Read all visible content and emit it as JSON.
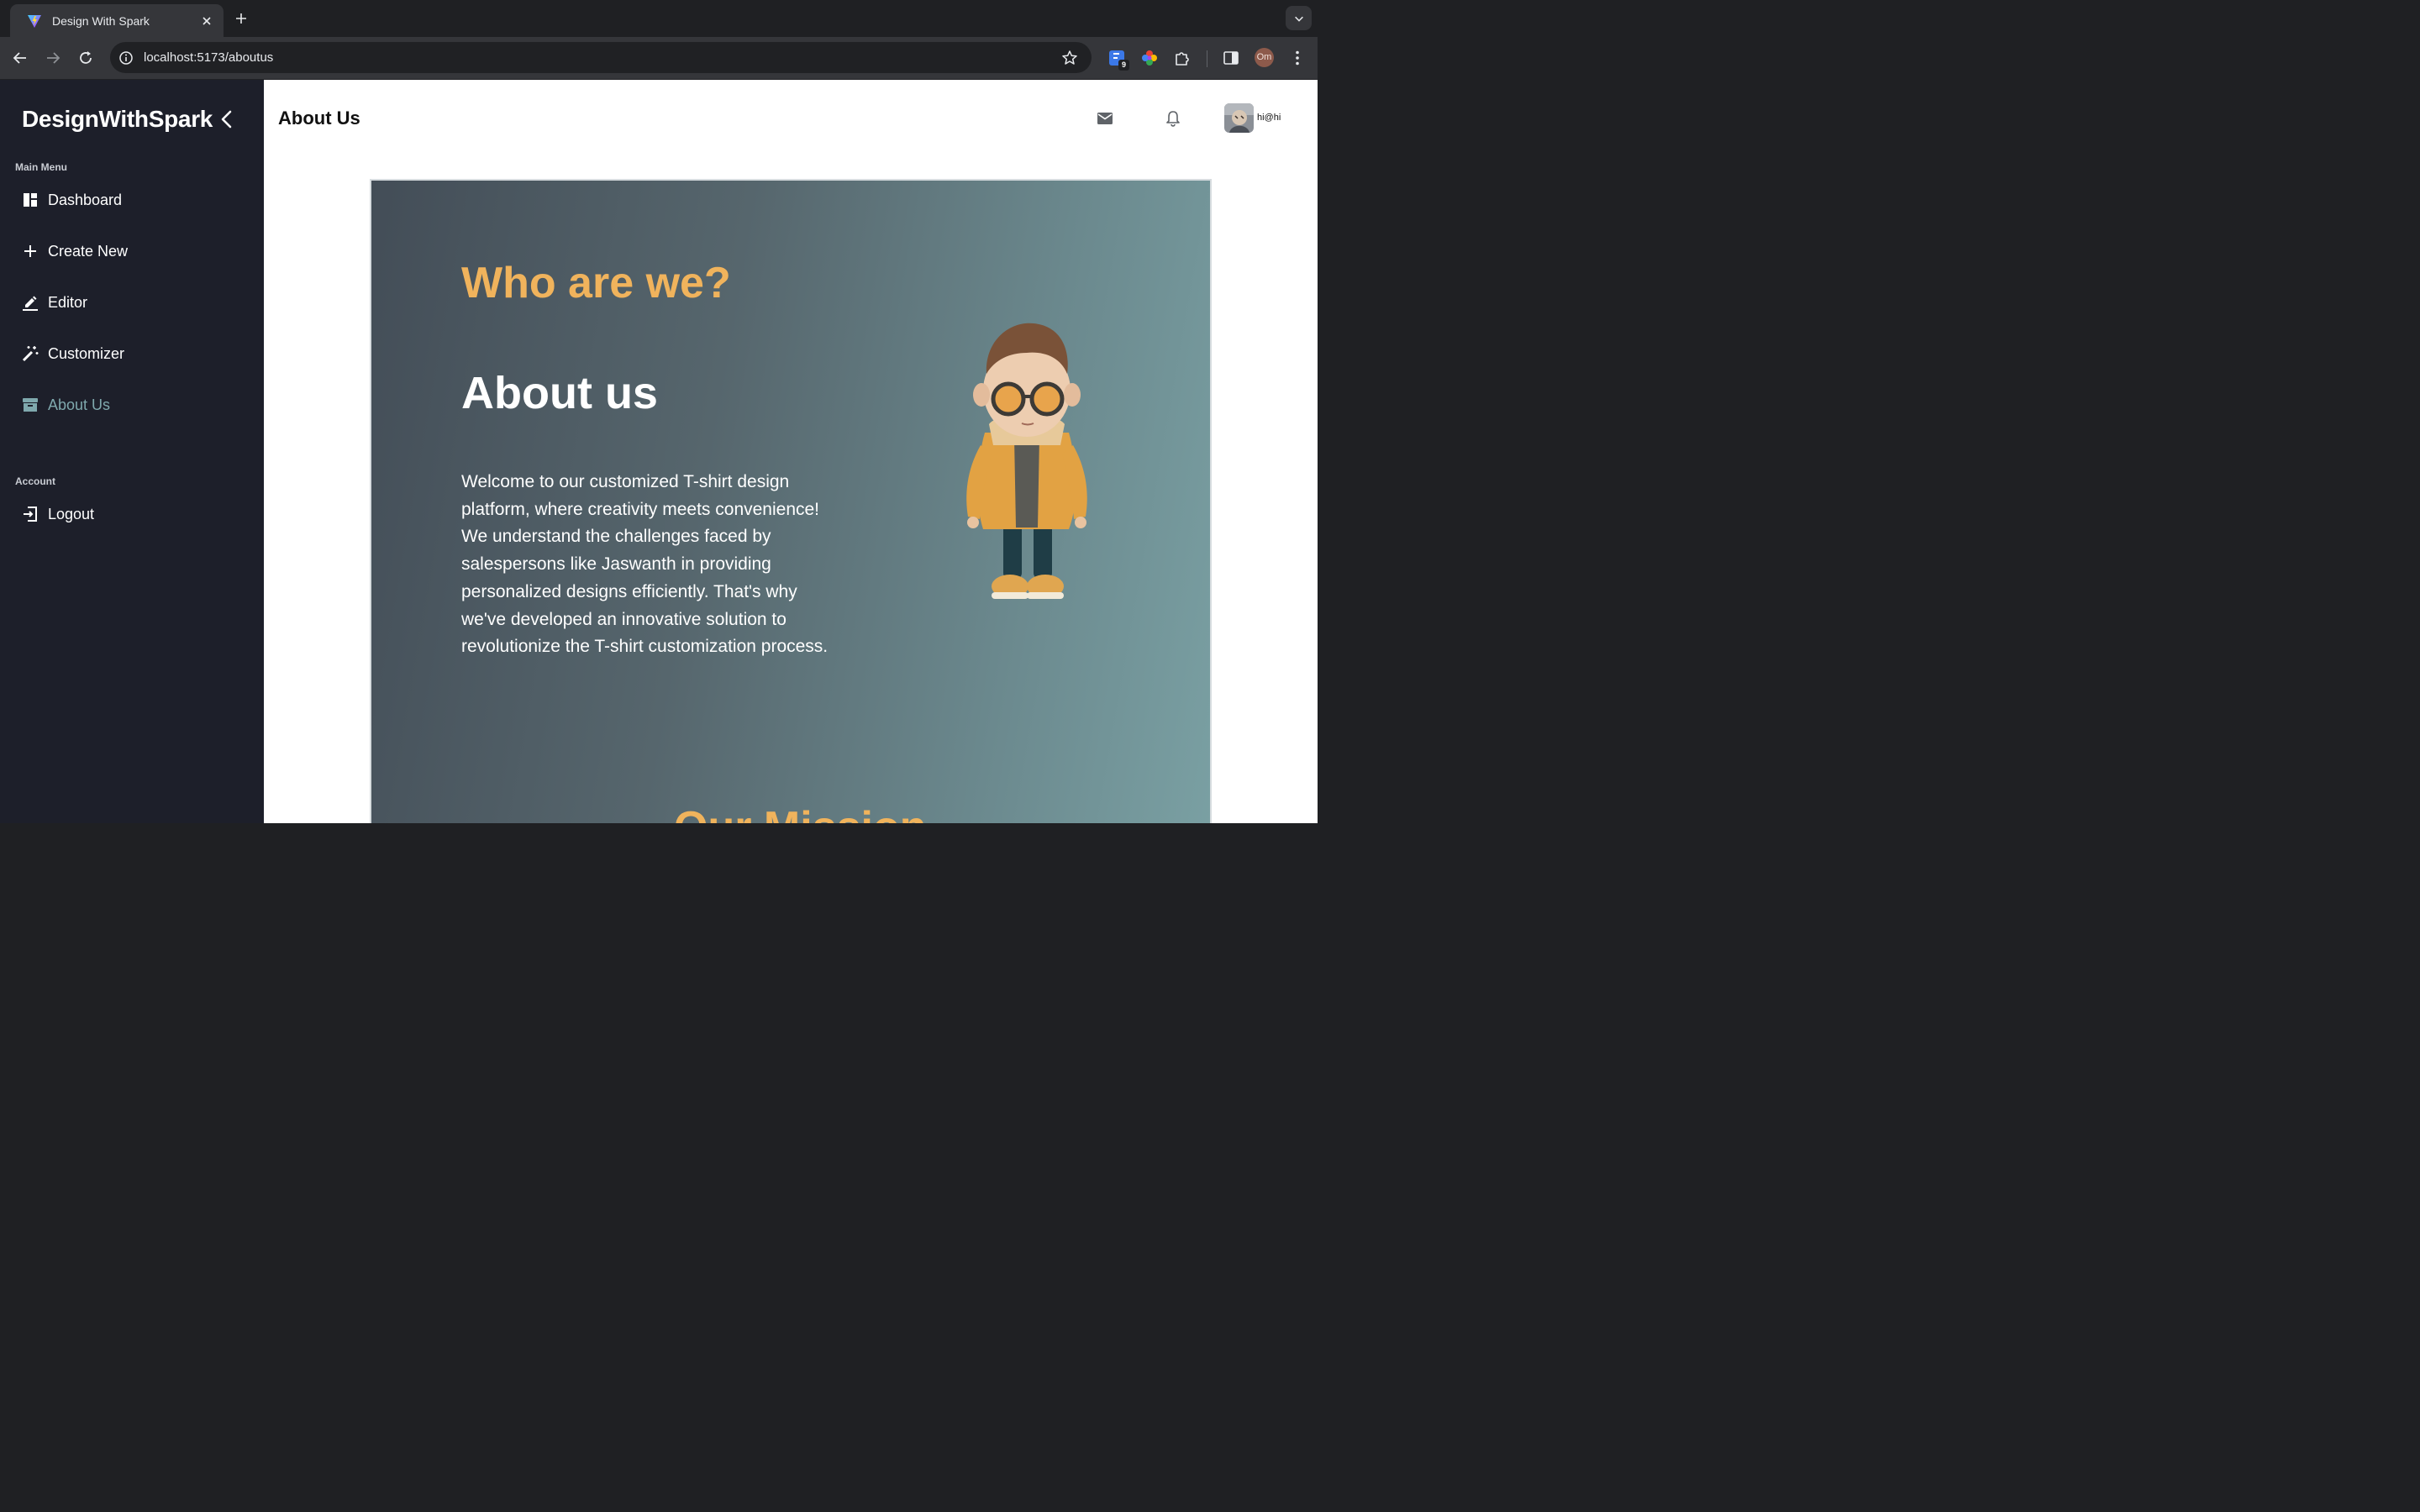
{
  "browser": {
    "tab_title": "Design With Spark",
    "url": "localhost:5173/aboutus",
    "extension_badge": "9",
    "profile_initials": "Om"
  },
  "sidebar": {
    "brand": "DesignWithSpark",
    "main_menu_label": "Main Menu",
    "items": [
      {
        "label": "Dashboard",
        "icon": "dashboard-icon"
      },
      {
        "label": "Create New",
        "icon": "plus-icon"
      },
      {
        "label": "Editor",
        "icon": "edit-icon"
      },
      {
        "label": "Customizer",
        "icon": "magic-wand-icon"
      },
      {
        "label": "About Us",
        "icon": "archive-icon",
        "active": true
      }
    ],
    "account_label": "Account",
    "logout_label": "Logout"
  },
  "header": {
    "title": "About Us",
    "user": "hi@hi"
  },
  "hero": {
    "question": "Who are we?",
    "heading": "About us",
    "paragraph": "Welcome to our customized T-shirt design platform, where creativity meets convenience! We understand the challenges faced by salespersons like Jaswanth in providing personalized designs efficiently. That's why we've developed an innovative solution to revolutionize the T-shirt customization process.",
    "mission_heading": "Our Mission"
  },
  "colors": {
    "sidebar_bg": "#1d1f2a",
    "accent_orange": "#f0b35c",
    "active_nav": "#7fa8ad"
  }
}
